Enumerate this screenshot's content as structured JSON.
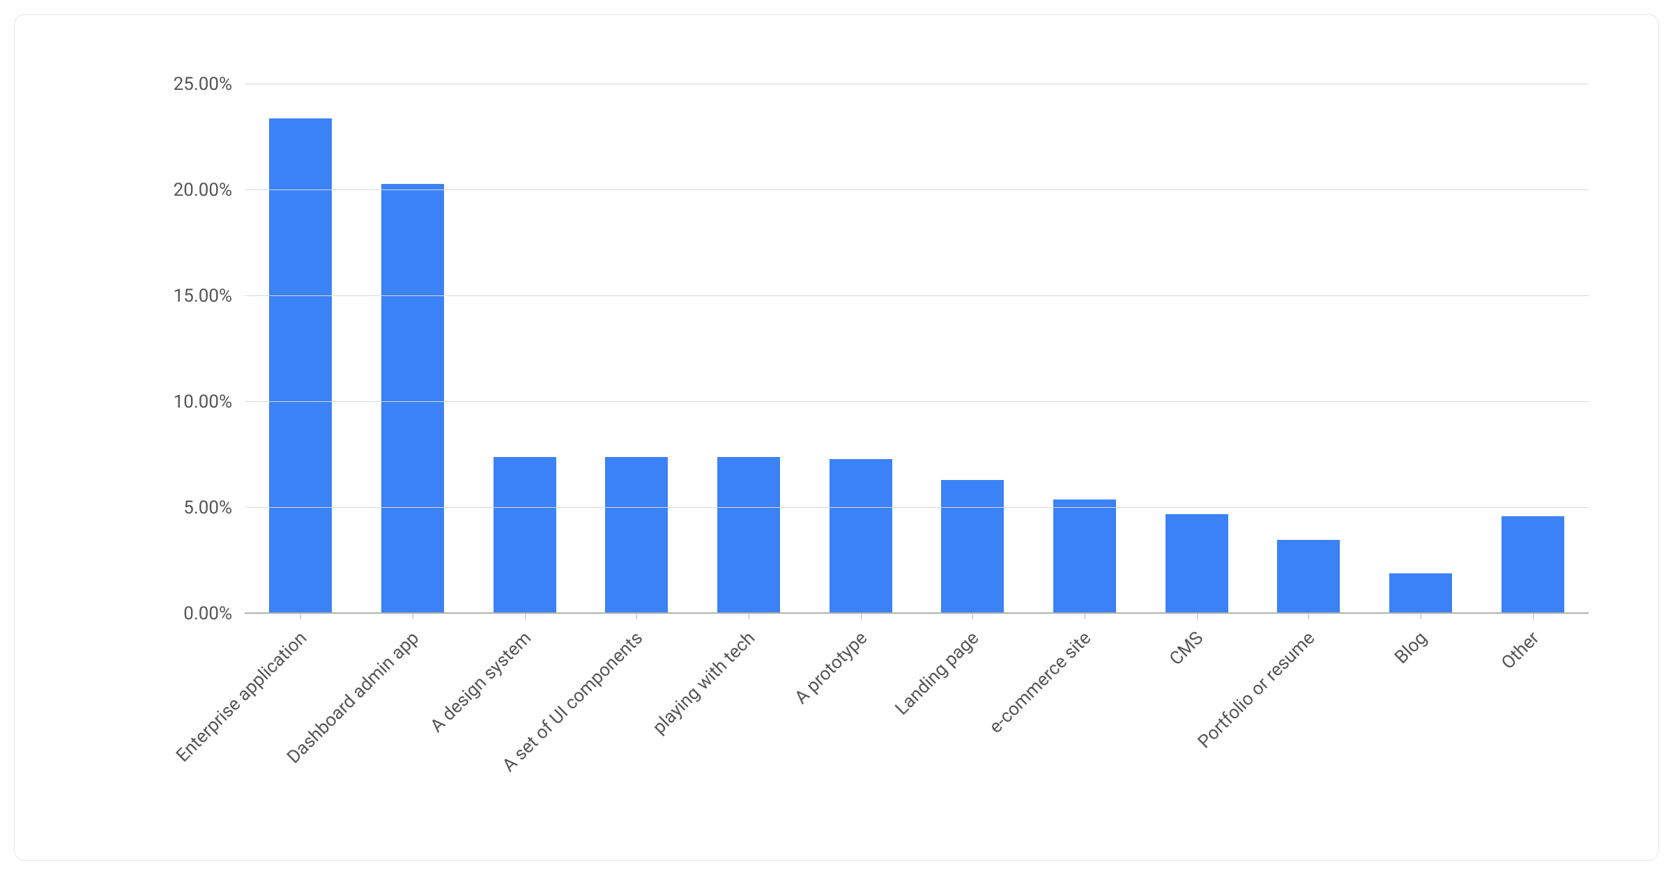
{
  "chart_data": {
    "type": "bar",
    "categories": [
      "Enterprise application",
      "Dashboard admin app",
      "A design system",
      "A set of UI components",
      "playing with tech",
      "A prototype",
      "Landing page",
      "e-commerce site",
      "CMS",
      "Portfolio or resume",
      "Blog",
      "Other"
    ],
    "values": [
      23.4,
      20.3,
      7.4,
      7.4,
      7.4,
      7.3,
      6.3,
      5.4,
      4.7,
      3.5,
      1.9,
      4.6
    ],
    "title": "",
    "xlabel": "",
    "ylabel": "",
    "ylim": [
      0,
      25
    ],
    "y_ticks": [
      0,
      5,
      10,
      15,
      20,
      25
    ],
    "y_tick_labels": [
      "0.00%",
      "5.00%",
      "10.00%",
      "15.00%",
      "20.00%",
      "25.00%"
    ],
    "bar_color": "#3b82f6",
    "grid": true
  }
}
